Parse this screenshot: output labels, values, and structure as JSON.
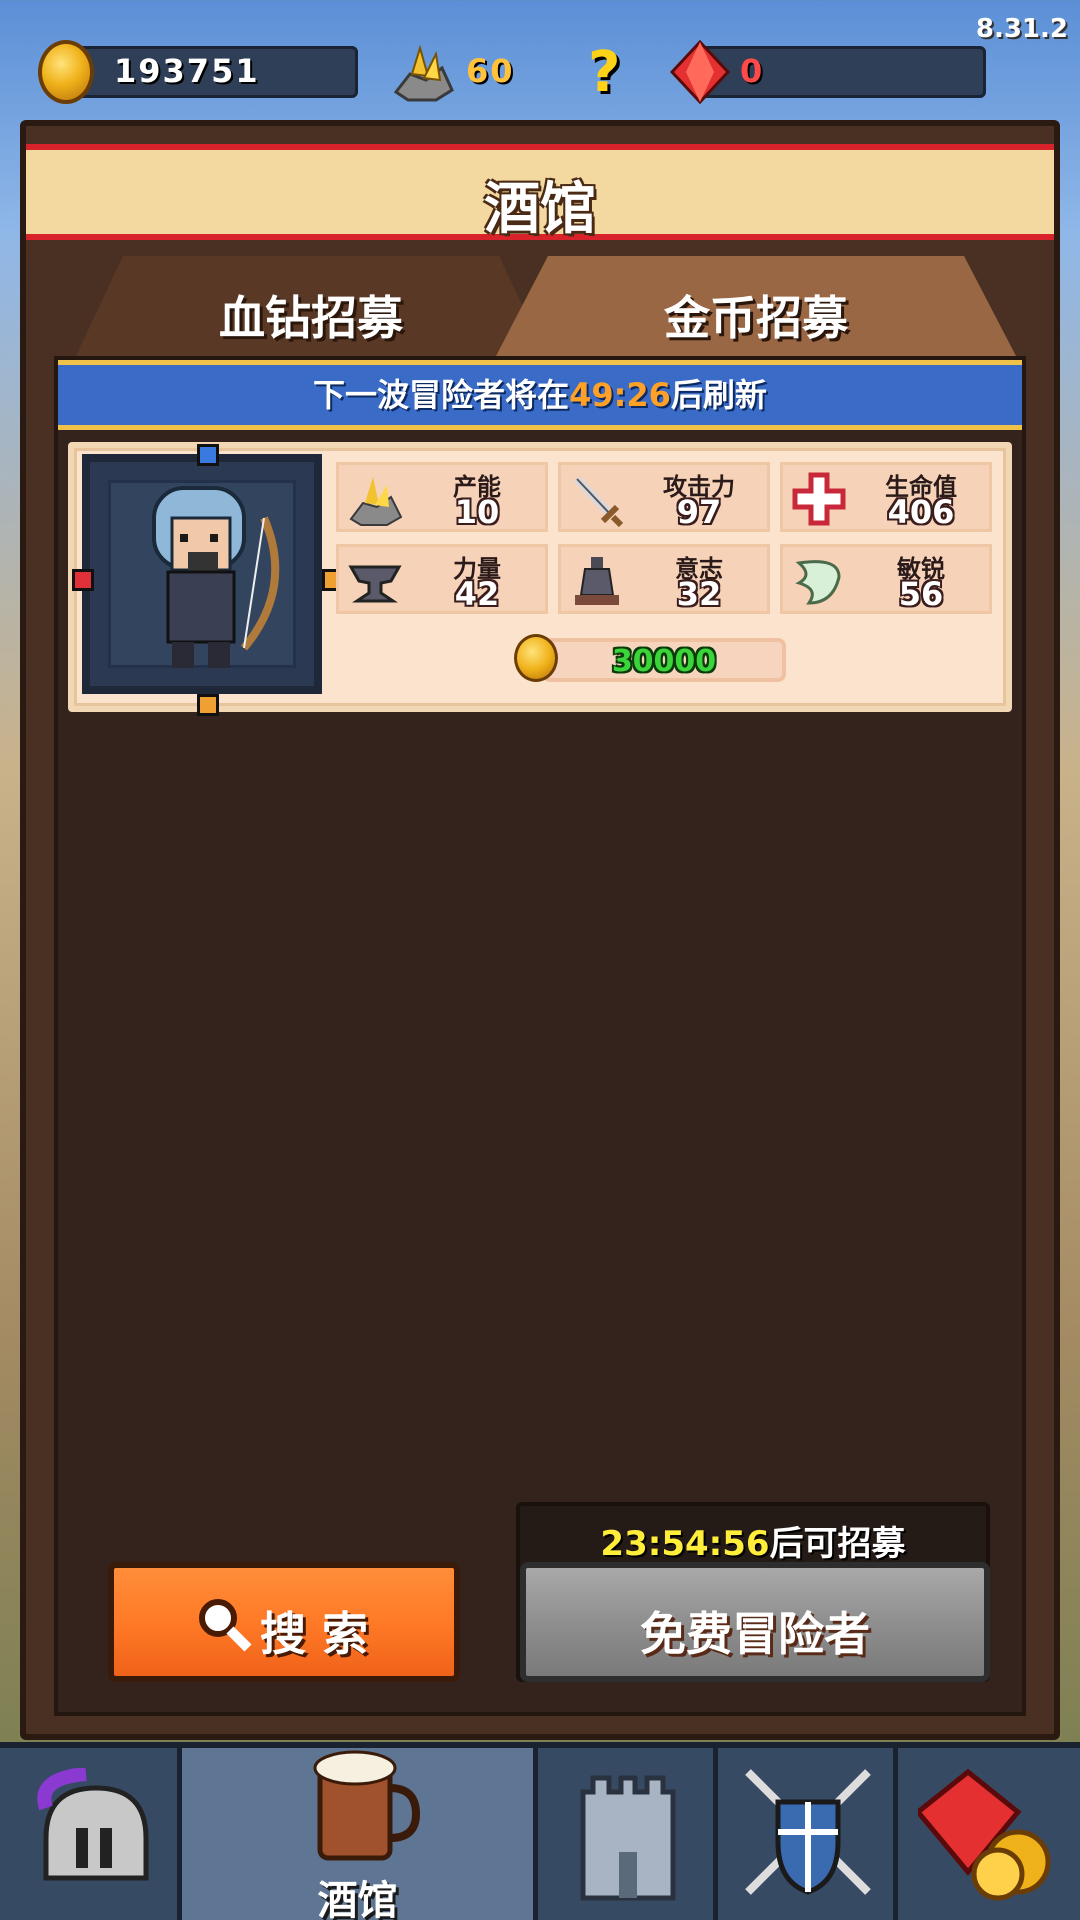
{
  "version": "8.31.2",
  "resources": {
    "gold": "193751",
    "ore": "60",
    "help": "?",
    "gems": "0"
  },
  "panel": {
    "title": "酒馆",
    "tabs": [
      {
        "label": "血钻招募"
      },
      {
        "label": "金币招募"
      }
    ],
    "refresh": {
      "prefix": "下一波冒险者将在",
      "time": "49:26",
      "suffix": "后刷新"
    }
  },
  "adventurer": {
    "stats": [
      {
        "label": "产能",
        "value": "10",
        "icon": "ore-icon"
      },
      {
        "label": "攻击力",
        "value": "97",
        "icon": "sword-icon"
      },
      {
        "label": "生命值",
        "value": "406",
        "icon": "health-cross-icon"
      },
      {
        "label": "力量",
        "value": "42",
        "icon": "anvil-icon"
      },
      {
        "label": "意志",
        "value": "32",
        "icon": "statue-icon"
      },
      {
        "label": "敏锐",
        "value": "56",
        "icon": "wing-icon"
      }
    ],
    "price": "30000"
  },
  "buttons": {
    "search_label": "搜 索",
    "free_label": "免费冒险者",
    "free_timer": "23:54:56",
    "free_timer_suffix": "后可招募"
  },
  "nav": {
    "items": [
      {
        "icon": "helmet-icon",
        "label": ""
      },
      {
        "icon": "tavern-mug-icon",
        "label": "酒馆"
      },
      {
        "icon": "castle-tower-icon",
        "label": ""
      },
      {
        "icon": "crossed-swords-shield-icon",
        "label": ""
      },
      {
        "icon": "gem-coins-icon",
        "label": ""
      }
    ]
  },
  "colors": {
    "accent_gold": "#ffc23a",
    "timer_yellow": "#ffee3a",
    "price_green": "#3bd43b",
    "refresh_orange": "#ffa126",
    "search_orange": "#ff7a26"
  }
}
